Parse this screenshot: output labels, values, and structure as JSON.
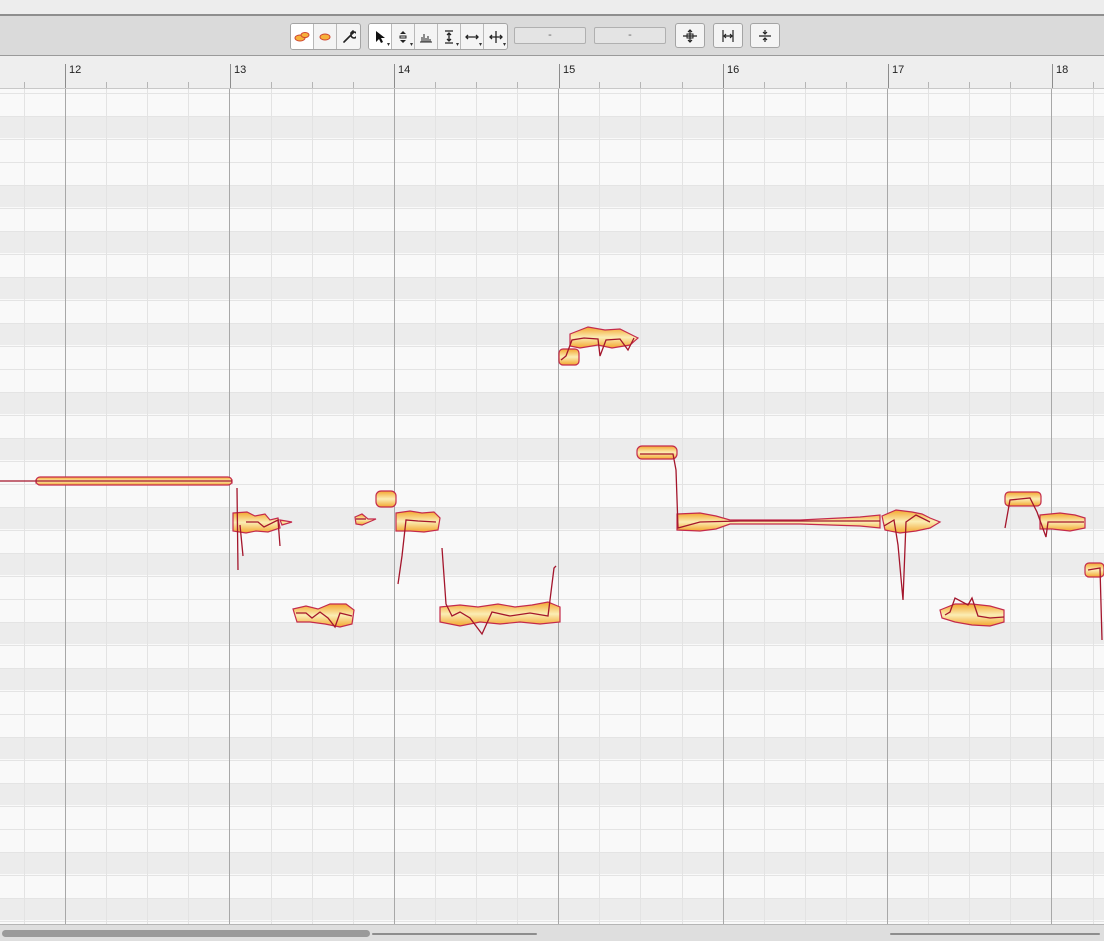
{
  "window": {
    "title": ""
  },
  "toolbar": {
    "field_left_value": "-",
    "field_right_value": "-",
    "icons": {
      "note_blob": "blob-icon",
      "note_single": "single-blob-icon",
      "wrench": "wrench-icon",
      "pointer": "pointer-tool-icon",
      "pitch": "pitch-tool-icon",
      "formant": "formant-tool-icon",
      "amplitude": "amplitude-tool-icon",
      "time": "time-tool-icon",
      "separation": "separation-tool-icon",
      "quantize_pitch": "quantize-pitch-icon",
      "quantize_time": "quantize-time-icon",
      "snap": "snap-icon"
    }
  },
  "ruler": {
    "bars": [
      "12",
      "13",
      "14",
      "15",
      "16",
      "17",
      "18"
    ]
  },
  "colors": {
    "blob_outline": "#c0254a",
    "blob_fill_outer": "#f3b238",
    "blob_fill_inner": "#f9e6a8",
    "pitch_curve": "#a4162c",
    "accent_active": "#e06838"
  },
  "notes_description_count": 0
}
